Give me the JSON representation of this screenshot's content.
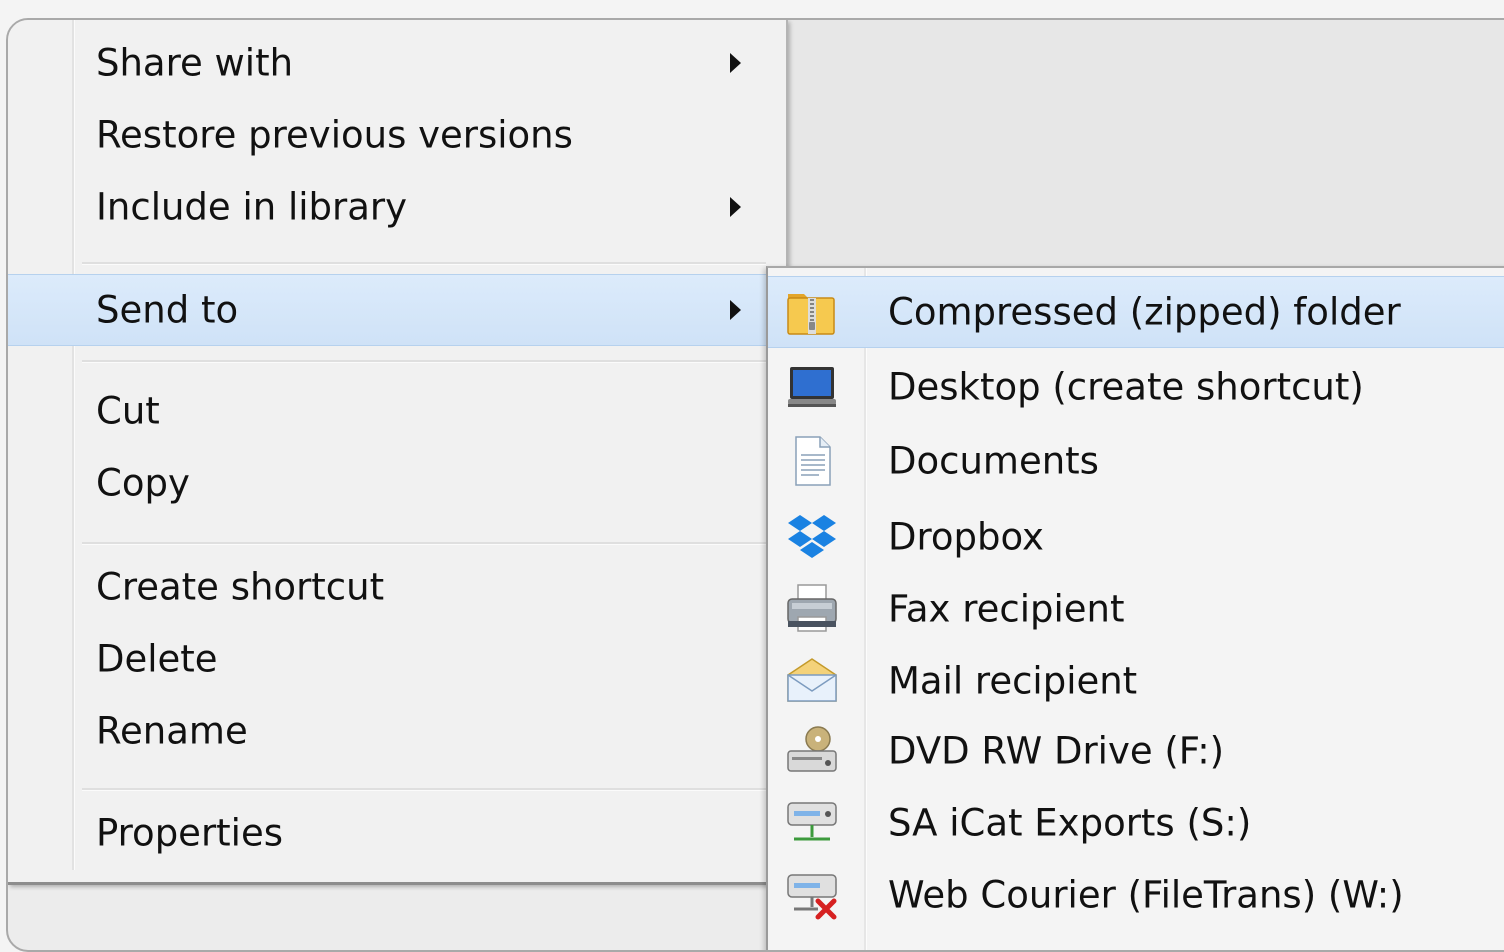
{
  "main_menu": {
    "items": [
      {
        "label": "Share with",
        "submenu": true
      },
      {
        "label": "Restore previous versions",
        "submenu": false
      },
      {
        "label": "Include in library",
        "submenu": true
      },
      {
        "label": "Send to",
        "submenu": true,
        "highlighted": true
      },
      {
        "label": "Cut",
        "submenu": false
      },
      {
        "label": "Copy",
        "submenu": false
      },
      {
        "label": "Create shortcut",
        "submenu": false
      },
      {
        "label": "Delete",
        "submenu": false
      },
      {
        "label": "Rename",
        "submenu": false
      },
      {
        "label": "Properties",
        "submenu": false
      }
    ]
  },
  "send_to_menu": {
    "items": [
      {
        "label": "Compressed (zipped) folder",
        "icon": "zip-folder-icon",
        "highlighted": true
      },
      {
        "label": "Desktop (create shortcut)",
        "icon": "desktop-icon"
      },
      {
        "label": "Documents",
        "icon": "document-icon"
      },
      {
        "label": "Dropbox",
        "icon": "dropbox-icon"
      },
      {
        "label": "Fax recipient",
        "icon": "fax-printer-icon"
      },
      {
        "label": "Mail recipient",
        "icon": "mail-envelope-icon"
      },
      {
        "label": "DVD RW Drive (F:)",
        "icon": "dvd-drive-icon"
      },
      {
        "label": "SA iCat Exports (S:)",
        "icon": "network-drive-icon"
      },
      {
        "label": "Web Courier (FileTrans) (W:)",
        "icon": "disconnected-network-drive-icon"
      }
    ]
  },
  "colors": {
    "highlight": "#cfe2f7",
    "highlight_border": "#b6d1ee",
    "menu_background": "#f1f1f1"
  }
}
